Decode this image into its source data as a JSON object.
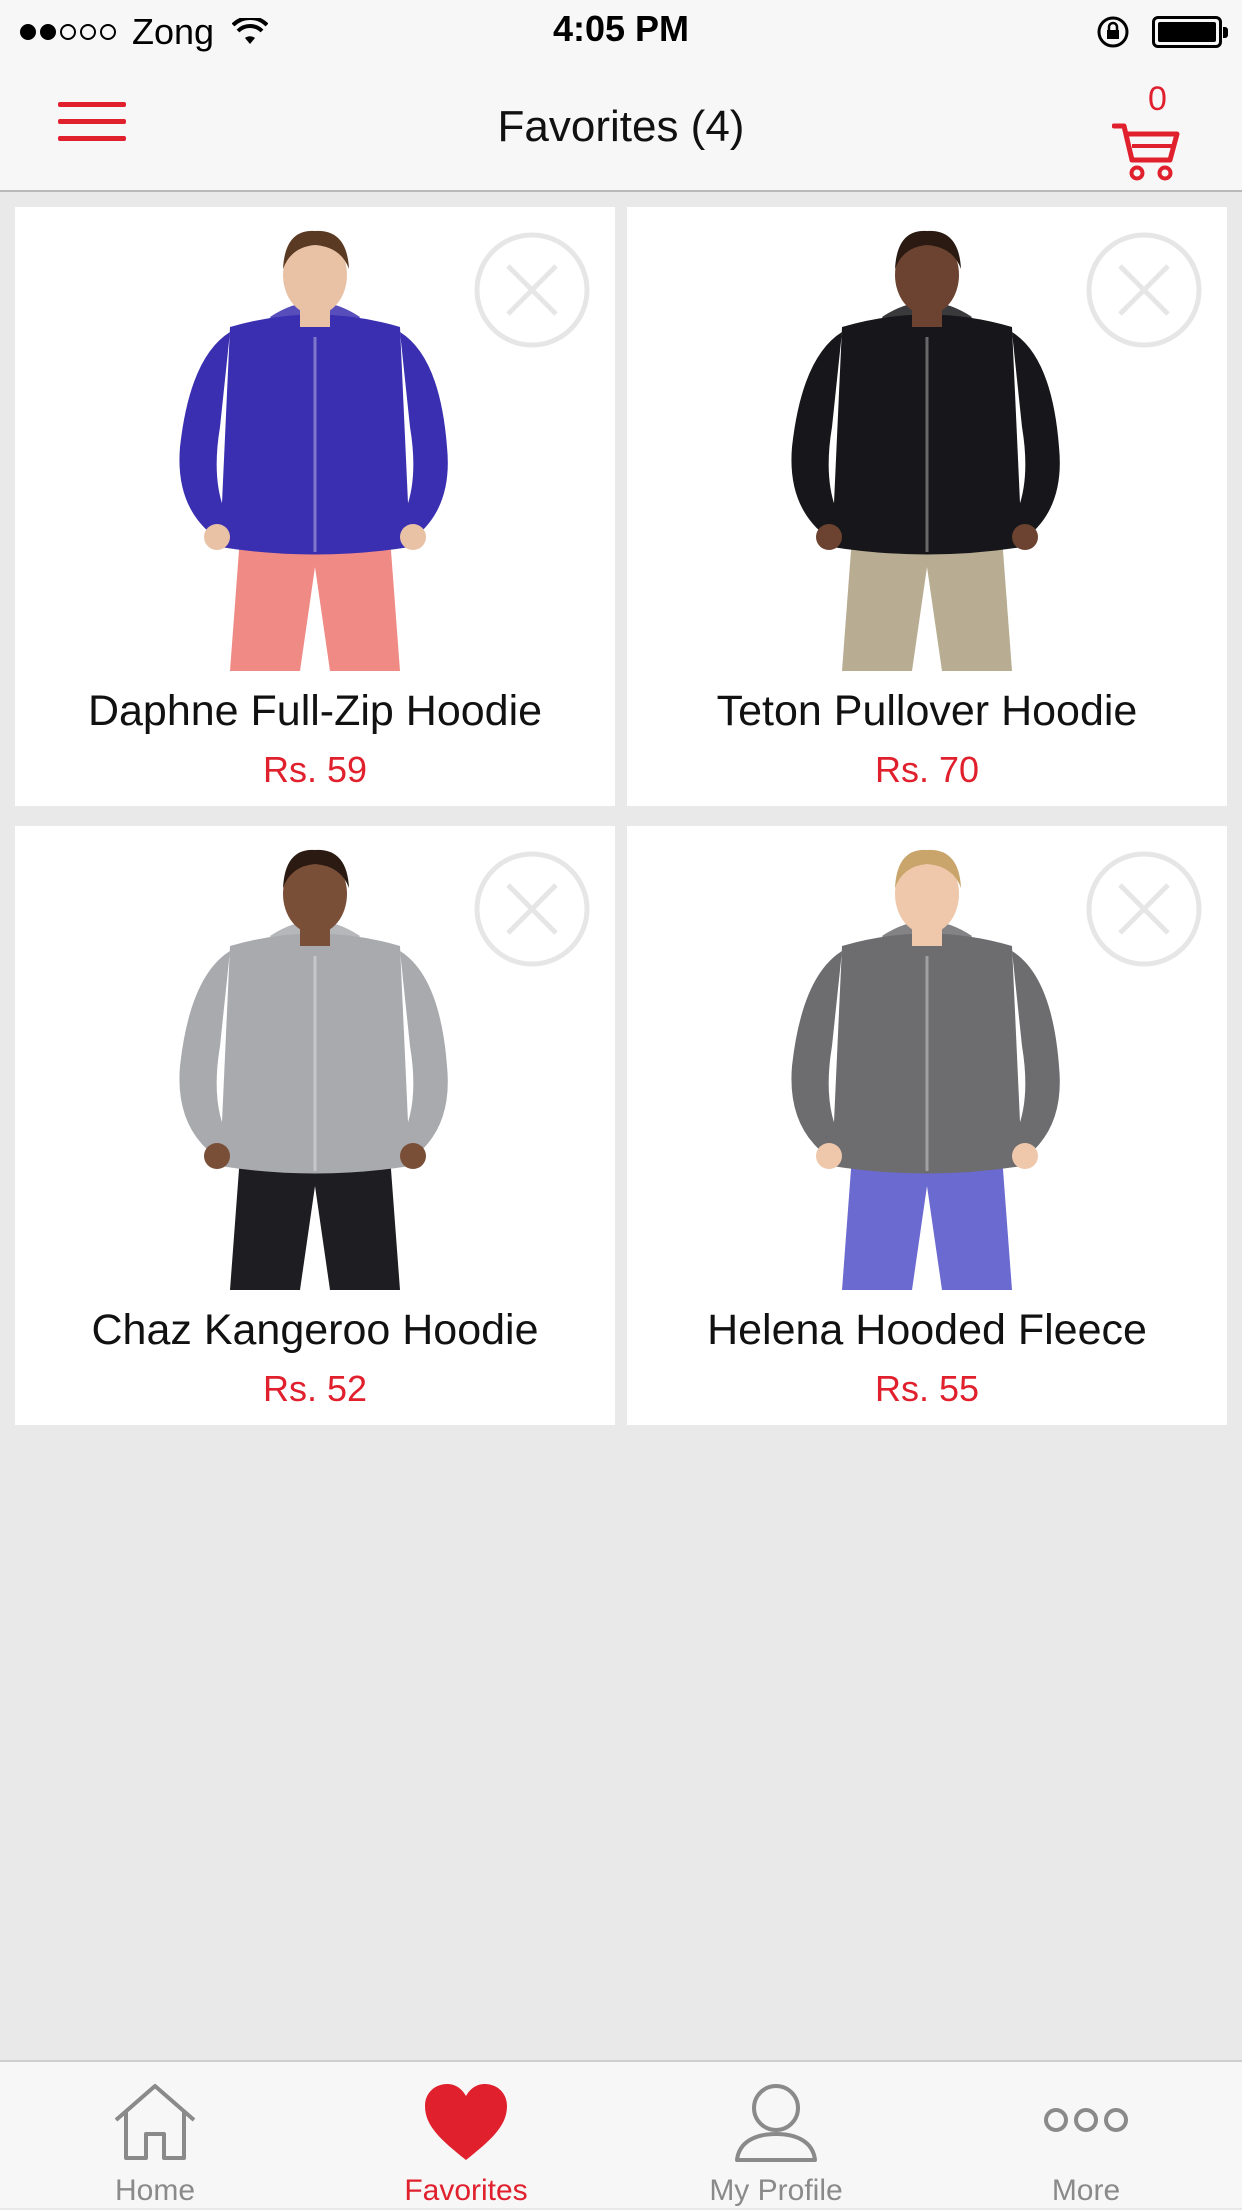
{
  "status_bar": {
    "carrier": "Zong",
    "time": "4:05 PM",
    "signal_bars_filled": 2,
    "signal_bars_total": 5,
    "battery_level": 1.0
  },
  "header": {
    "title": "Favorites (4)",
    "cart_count": "0",
    "icons": {
      "menu": "hamburger-menu-icon",
      "cart": "cart-icon"
    }
  },
  "products": [
    {
      "name": "Daphne Full-Zip Hoodie",
      "price": "Rs. 59",
      "image": "woman in blue full-zip hoodie and pink pants",
      "top_color": "#3a2fb0",
      "bottom_color": "#f08a84",
      "skin": "#e9c2a6",
      "hair": "#5b3a24"
    },
    {
      "name": "Teton Pullover Hoodie",
      "price": "Rs. 70",
      "image": "man in black pullover hoodie and khaki pants",
      "top_color": "#17171b",
      "bottom_color": "#b8ad92",
      "skin": "#6b4330",
      "hair": "#2a1a12"
    },
    {
      "name": "Chaz Kangeroo Hoodie",
      "price": "Rs. 52",
      "image": "man in grey kangaroo hoodie and black pants",
      "top_color": "#a9aaae",
      "bottom_color": "#1e1e22",
      "skin": "#7a4f38",
      "hair": "#2a1a12"
    },
    {
      "name": "Helena Hooded Fleece",
      "price": "Rs. 55",
      "image": "woman in grey hooded fleece and blue leggings",
      "top_color": "#6d6d70",
      "bottom_color": "#6b6ad0",
      "skin": "#efc8ac",
      "hair": "#c9a46b"
    }
  ],
  "tabs": [
    {
      "label": "Home",
      "icon": "home-icon",
      "active": false
    },
    {
      "label": "Favorites",
      "icon": "heart-icon",
      "active": true
    },
    {
      "label": "My Profile",
      "icon": "profile-icon",
      "active": false
    },
    {
      "label": "More",
      "icon": "more-icon",
      "active": false
    }
  ],
  "colors": {
    "accent": "#e0202d",
    "inactive": "#8a8a8a",
    "background": "#e9e9e9"
  }
}
